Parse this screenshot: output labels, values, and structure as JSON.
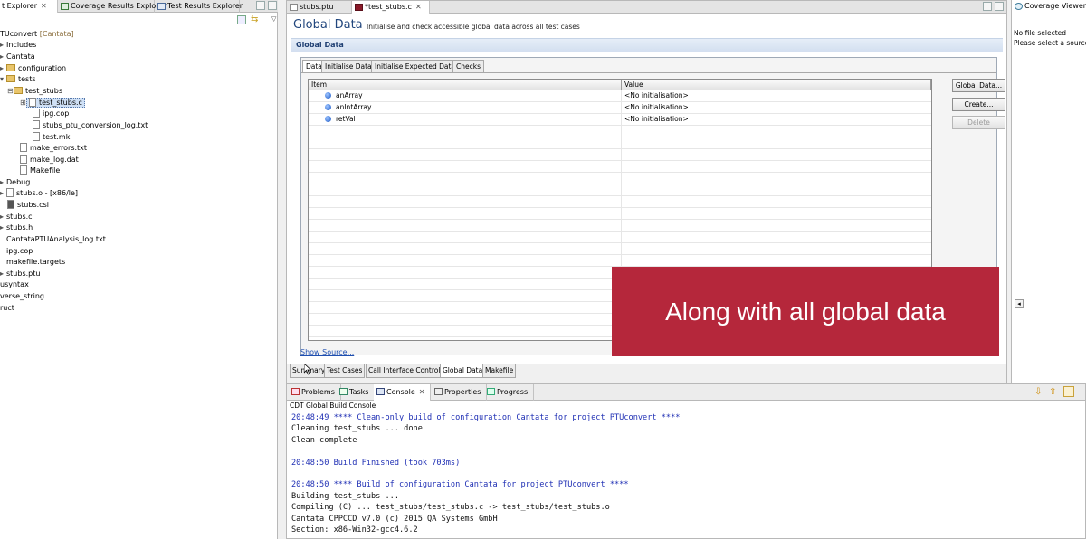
{
  "left_panel": {
    "tabs": [
      "t Explorer",
      "Coverage Results Explorer",
      "Test Results Explorer"
    ],
    "tree": [
      {
        "label": "TUconvert",
        "suffix": "[Cantata]"
      },
      {
        "label": "Includes"
      },
      {
        "label": "Cantata"
      },
      {
        "label": "configuration"
      },
      {
        "label": "tests"
      },
      {
        "label": "test_stubs"
      },
      {
        "label": "test_stubs.c"
      },
      {
        "label": "ipg.cop"
      },
      {
        "label": "stubs_ptu_conversion_log.txt"
      },
      {
        "label": "test.mk"
      },
      {
        "label": "make_errors.txt"
      },
      {
        "label": "make_log.dat"
      },
      {
        "label": "Makefile"
      },
      {
        "label": "Debug"
      },
      {
        "label": "stubs.o - [x86/le]"
      },
      {
        "label": "stubs.csi"
      },
      {
        "label": "stubs.c"
      },
      {
        "label": "stubs.h"
      },
      {
        "label": "CantataPTUAnalysis_log.txt"
      },
      {
        "label": "ipg.cop"
      },
      {
        "label": "makefile.targets"
      },
      {
        "label": "stubs.ptu"
      },
      {
        "label": "usyntax"
      },
      {
        "label": "verse_string"
      },
      {
        "label": "ruct"
      }
    ]
  },
  "editor": {
    "tabs": [
      "stubs.ptu",
      "*test_stubs.c"
    ],
    "title": "Global Data",
    "subtitle": "Initialise and check accessible global data across all test cases",
    "section": "Global Data",
    "inner_tabs": [
      "Data",
      "Initialise Data",
      "Initialise Expected Data",
      "Checks"
    ],
    "columns": [
      "Item",
      "Value"
    ],
    "rows": [
      {
        "item": "anArray",
        "value": "<No initialisation>"
      },
      {
        "item": "anIntArray",
        "value": "<No initialisation>"
      },
      {
        "item": "retVal",
        "value": "<No initialisation>"
      }
    ],
    "buttons": {
      "global_data": "Global Data...",
      "create": "Create...",
      "delete": "Delete"
    },
    "show_source": "Show Source...",
    "bottom_tabs": [
      "Summary",
      "Test Cases",
      "Call Interface Control",
      "Global Data",
      "Makefile"
    ]
  },
  "console": {
    "tabs": [
      "Problems",
      "Tasks",
      "Console",
      "Properties",
      "Progress"
    ],
    "header": "CDT Global Build Console",
    "lines": [
      {
        "text": "20:48:49 **** Clean-only build of configuration Cantata for project PTUconvert ****",
        "blue": true
      },
      {
        "text": "Cleaning test_stubs ... done",
        "blue": false
      },
      {
        "text": "Clean complete",
        "blue": false
      },
      {
        "text": "",
        "blue": false
      },
      {
        "text": "20:48:50 Build Finished (took 703ms)",
        "blue": true
      },
      {
        "text": "",
        "blue": false
      },
      {
        "text": "20:48:50 **** Build of configuration Cantata for project PTUconvert ****",
        "blue": true
      },
      {
        "text": "Building test_stubs ...",
        "blue": false
      },
      {
        "text": "Compiling (C) ... test_stubs/test_stubs.c -> test_stubs/test_stubs.o",
        "blue": false
      },
      {
        "text": "Cantata CPPCCD v7.0 (c) 2015 QA Systems GmbH",
        "blue": false
      },
      {
        "text": "Section: x86-Win32-gcc4.6.2",
        "blue": false
      }
    ]
  },
  "right_panel": {
    "tab": "Coverage Viewer",
    "line1": "No file selected",
    "line2": "Please select a source"
  },
  "overlay": {
    "caption": "Along with all global data"
  }
}
